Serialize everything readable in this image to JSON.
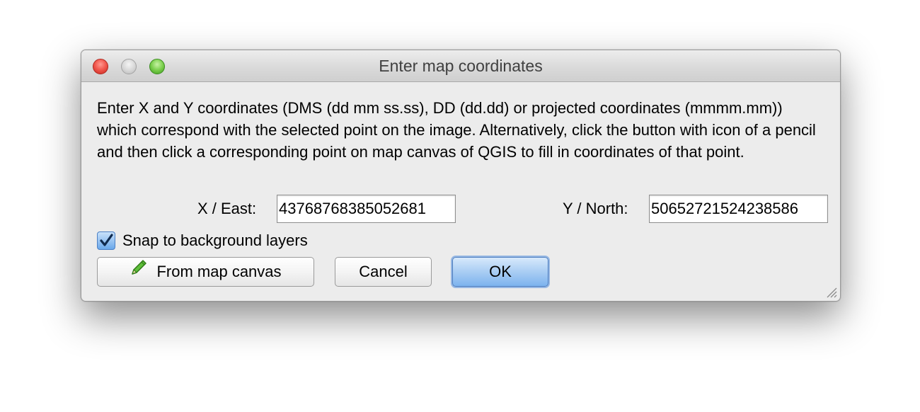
{
  "window": {
    "title": "Enter map coordinates"
  },
  "description": "Enter X and Y coordinates (DMS (dd mm ss.ss), DD (dd.dd) or projected coordinates (mmmm.mm)) which correspond with the selected point on the image. Alternatively, click the button with icon of a pencil and then click a corresponding point on map canvas of QGIS to fill in coordinates of that point.",
  "x_field": {
    "label": "X / East:",
    "value": "43768768385052681"
  },
  "y_field": {
    "label": "Y / North:",
    "value": "50652721524238586"
  },
  "snap": {
    "label": "Snap to background layers",
    "checked": true
  },
  "buttons": {
    "from_canvas": "From map canvas",
    "cancel": "Cancel",
    "ok": "OK"
  },
  "icons": {
    "from_canvas": "pencil-icon"
  },
  "colors": {
    "default_button": "#7db3ee",
    "close": "#f25a50",
    "maximize": "#7bcf4d"
  }
}
